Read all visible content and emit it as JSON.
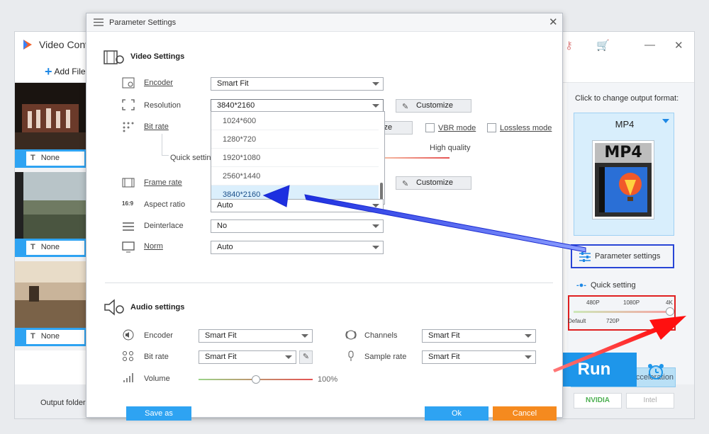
{
  "app": {
    "title": "Video Conv",
    "add_files": "Add File",
    "output_folder_label": "Output folder:",
    "thumbnails": [
      {
        "subtitle": "None"
      },
      {
        "subtitle": "None"
      },
      {
        "subtitle": "None"
      }
    ],
    "right_panel": {
      "click_to_change": "Click to change output format:",
      "format": "MP4",
      "format_logo_text": "MP4",
      "parameter_settings": "Parameter settings",
      "quick_setting": "Quick setting",
      "quick_ticks_top": [
        "480P",
        "1080P",
        "4K"
      ],
      "quick_ticks_bottom": [
        "Default",
        "720P"
      ],
      "quick_value": "4K",
      "hardware_acceleration": "Hardware acceleration",
      "nvidia": "NVIDIA",
      "intel": "Intel"
    },
    "run_label": "Run"
  },
  "dialog": {
    "title": "Parameter Settings",
    "video": {
      "section_title": "Video Settings",
      "encoder_label": "Encoder",
      "encoder_value": "Smart Fit",
      "resolution_label": "Resolution",
      "resolution_value": "3840*2160",
      "resolution_options": [
        "1024*600",
        "1280*720",
        "1920*1080",
        "2560*1440",
        "3840*2160"
      ],
      "customize_label": "Customize",
      "bitrate_label": "Bit rate",
      "bitrate_customize_partial": "ize",
      "vbr_mode": "VBR mode",
      "lossless_mode": "Lossless mode",
      "quick_setting_partial": "Quick setting",
      "high_quality": "High quality",
      "framerate_label": "Frame rate",
      "framerate_customize": "Customize",
      "aspect_label": "Aspect ratio",
      "aspect_value": "Auto",
      "deinterlace_label": "Deinterlace",
      "deinterlace_value": "No",
      "norm_label": "Norm",
      "norm_value": "Auto"
    },
    "audio": {
      "section_title": "Audio settings",
      "encoder_label": "Encoder",
      "encoder_value": "Smart Fit",
      "bitrate_label": "Bit rate",
      "bitrate_value": "Smart Fit",
      "volume_label": "Volume",
      "volume_value": "100%",
      "volume_level": 0.5,
      "channels_label": "Channels",
      "channels_value": "Smart Fit",
      "samplerate_label": "Sample rate",
      "samplerate_value": "Smart Fit"
    },
    "buttons": {
      "save_as": "Save as",
      "ok": "Ok",
      "cancel": "Cancel"
    }
  },
  "colors": {
    "accent_blue": "#1e96ea",
    "cancel_orange": "#f58a1f",
    "annotation_blue": "#2845d6",
    "annotation_red": "#e02020"
  }
}
